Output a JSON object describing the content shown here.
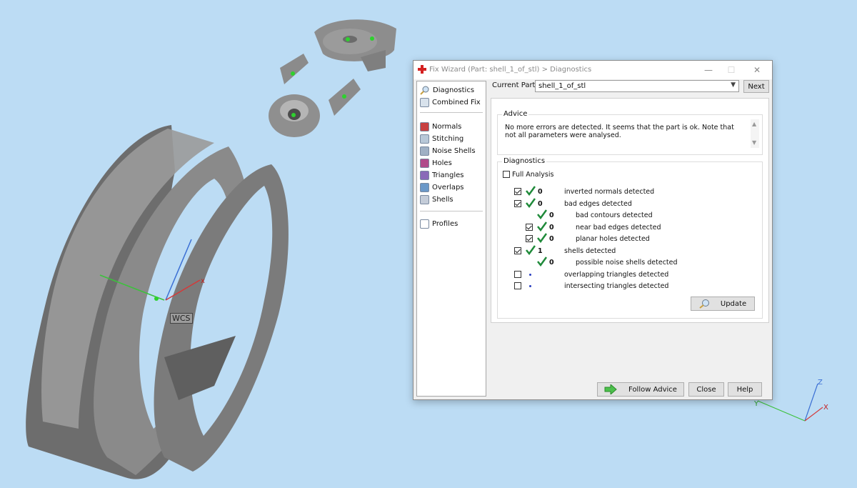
{
  "viewport": {
    "wcs_label": "WCS",
    "axis_labels": {
      "x": "X",
      "y": "Y",
      "z": "Z",
      "local_x": "x"
    }
  },
  "dialog": {
    "title": "Fix Wizard (Part: shell_1_of_stl) > Diagnostics",
    "title_buttons": {
      "minimize": "—",
      "maximize": "☐",
      "close": "✕"
    },
    "nav": {
      "top": [
        {
          "label": "Diagnostics",
          "icon": "magnifier-icon"
        },
        {
          "label": "Combined Fix",
          "icon": "combined-fix-icon"
        }
      ],
      "tools": [
        {
          "label": "Normals",
          "icon": "normals-icon"
        },
        {
          "label": "Stitching",
          "icon": "stitching-icon"
        },
        {
          "label": "Noise Shells",
          "icon": "noise-shells-icon"
        },
        {
          "label": "Holes",
          "icon": "holes-icon"
        },
        {
          "label": "Triangles",
          "icon": "triangles-icon"
        },
        {
          "label": "Overlaps",
          "icon": "overlaps-icon"
        },
        {
          "label": "Shells",
          "icon": "shells-icon"
        }
      ],
      "bottom": [
        {
          "label": "Profiles",
          "icon": "profiles-icon"
        }
      ]
    },
    "current_part_label": "Current Part:",
    "current_part_value": "shell_1_of_stl",
    "next_button": "Next",
    "advice": {
      "title": "Advice",
      "text": "No more errors are detected. It seems that the part is ok. Note that not all parameters were analysed."
    },
    "diagnostics": {
      "title": "Diagnostics",
      "full_analysis": {
        "label": "Full Analysis",
        "checked": false
      },
      "rows": [
        {
          "checkbox": true,
          "checked": true,
          "status": "ok",
          "count": "0",
          "label": "inverted normals detected",
          "indent": 0
        },
        {
          "checkbox": true,
          "checked": true,
          "status": "ok",
          "count": "0",
          "label": "bad edges detected",
          "indent": 0
        },
        {
          "checkbox": false,
          "checked": false,
          "status": "ok",
          "count": "0",
          "label": "bad contours detected",
          "indent": 1
        },
        {
          "checkbox": true,
          "checked": true,
          "status": "ok",
          "count": "0",
          "label": "near bad edges detected",
          "indent": 1
        },
        {
          "checkbox": true,
          "checked": true,
          "status": "ok",
          "count": "0",
          "label": "planar holes detected",
          "indent": 1
        },
        {
          "checkbox": true,
          "checked": true,
          "status": "ok",
          "count": "1",
          "label": "shells detected",
          "indent": 0
        },
        {
          "checkbox": false,
          "checked": false,
          "status": "ok",
          "count": "0",
          "label": "possible noise shells detected",
          "indent": 1
        },
        {
          "checkbox": true,
          "checked": false,
          "status": "pending",
          "count": "",
          "label": "overlapping triangles detected",
          "indent": 0
        },
        {
          "checkbox": true,
          "checked": false,
          "status": "pending",
          "count": "",
          "label": "intersecting triangles detected",
          "indent": 0
        }
      ],
      "update_button": "Update"
    },
    "buttons": {
      "follow_advice": "Follow Advice",
      "close": "Close",
      "help": "Help"
    },
    "colors": {
      "ok_tick": "#1f8a3a",
      "pending_dot": "#2a3fc0",
      "title_icon": "#d42020"
    }
  }
}
